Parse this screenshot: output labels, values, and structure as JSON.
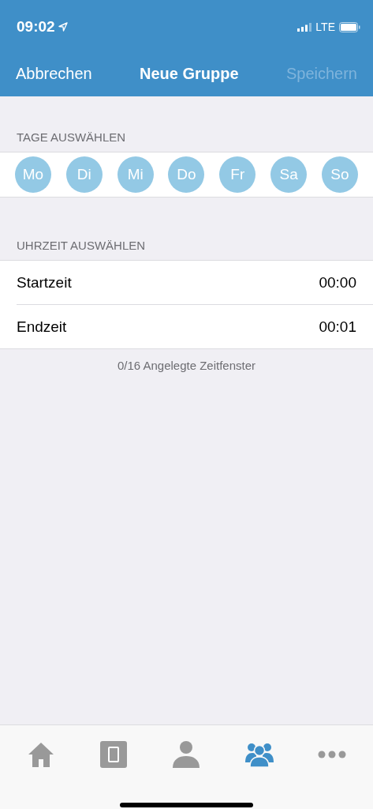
{
  "status_bar": {
    "time": "09:02",
    "network": "LTE"
  },
  "nav": {
    "cancel": "Abbrechen",
    "title": "Neue Gruppe",
    "save": {
      "label": "Speichern",
      "disabled": true
    }
  },
  "days_section": {
    "header": "TAGE AUSWÄHLEN",
    "days": [
      {
        "label": "Mo",
        "selected": false
      },
      {
        "label": "Di",
        "selected": false
      },
      {
        "label": "Mi",
        "selected": false
      },
      {
        "label": "Do",
        "selected": false
      },
      {
        "label": "Fr",
        "selected": false
      },
      {
        "label": "Sa",
        "selected": false
      },
      {
        "label": "So",
        "selected": false
      }
    ]
  },
  "time_section": {
    "header": "UHRZEIT AUSWÄHLEN",
    "rows": [
      {
        "label": "Startzeit",
        "value": "00:00"
      },
      {
        "label": "Endzeit",
        "value": "00:01"
      }
    ],
    "footer": "0/16 Angelegte Zeitfenster"
  },
  "tab_bar": [
    {
      "kind": "home",
      "selected": false
    },
    {
      "kind": "tablet",
      "selected": false
    },
    {
      "kind": "person",
      "selected": false
    },
    {
      "kind": "group",
      "selected": true
    },
    {
      "kind": "more",
      "selected": false
    }
  ]
}
